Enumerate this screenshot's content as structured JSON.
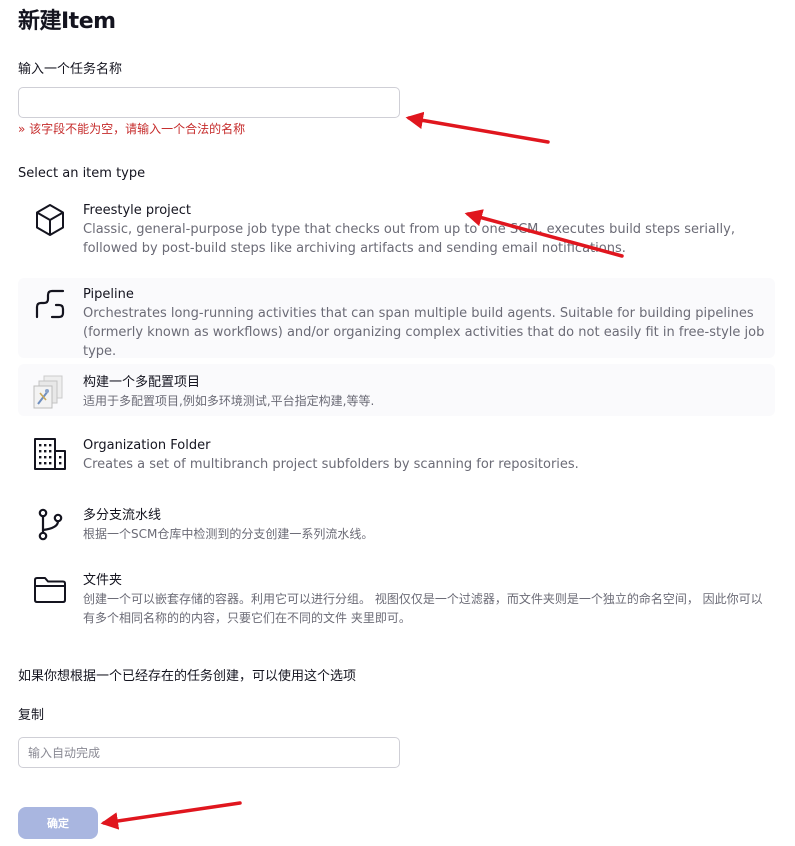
{
  "page": {
    "title": "新建Item"
  },
  "name_field": {
    "label": "输入一个任务名称",
    "value": "",
    "placeholder": "",
    "error": "» 该字段不能为空，请输入一个合法的名称"
  },
  "item_type": {
    "heading": "Select an item type",
    "items": [
      {
        "name": "Freestyle project",
        "icon": "cube-icon",
        "description": "Classic, general-purpose job type that checks out from up to one SCM, executes build steps serially, followed by post-build steps like archiving artifacts and sending email notifications."
      },
      {
        "name": "Pipeline",
        "icon": "pipeline-icon",
        "description": "Orchestrates long-running activities that can span multiple build agents. Suitable for building pipelines (formerly known as workflows) and/or organizing complex activities that do not easily fit in free-style job type."
      },
      {
        "name": "构建一个多配置项目",
        "icon": "multi-config-icon",
        "description": "适用于多配置项目,例如多环境测试,平台指定构建,等等."
      },
      {
        "name": "Organization Folder",
        "icon": "building-icon",
        "description": "Creates a set of multibranch project subfolders by scanning for repositories."
      },
      {
        "name": "多分支流水线",
        "icon": "branch-icon",
        "description": "根据一个SCM仓库中检测到的分支创建一系列流水线。"
      },
      {
        "name": "文件夹",
        "icon": "folder-icon",
        "description": "创建一个可以嵌套存储的容器。利用它可以进行分组。 视图仅仅是一个过滤器，而文件夹则是一个独立的命名空间， 因此你可以有多个相同名称的的内容，只要它们在不同的文件 夹里即可。"
      }
    ]
  },
  "copy_section": {
    "hint": "如果你想根据一个已经存在的任务创建，可以使用这个选项",
    "label": "复制",
    "placeholder": "输入自动完成"
  },
  "submit": {
    "label": "确定"
  },
  "colors": {
    "error": "#c62c2c",
    "button": "#a9b6e0",
    "annotation_arrow": "#e0161e"
  }
}
